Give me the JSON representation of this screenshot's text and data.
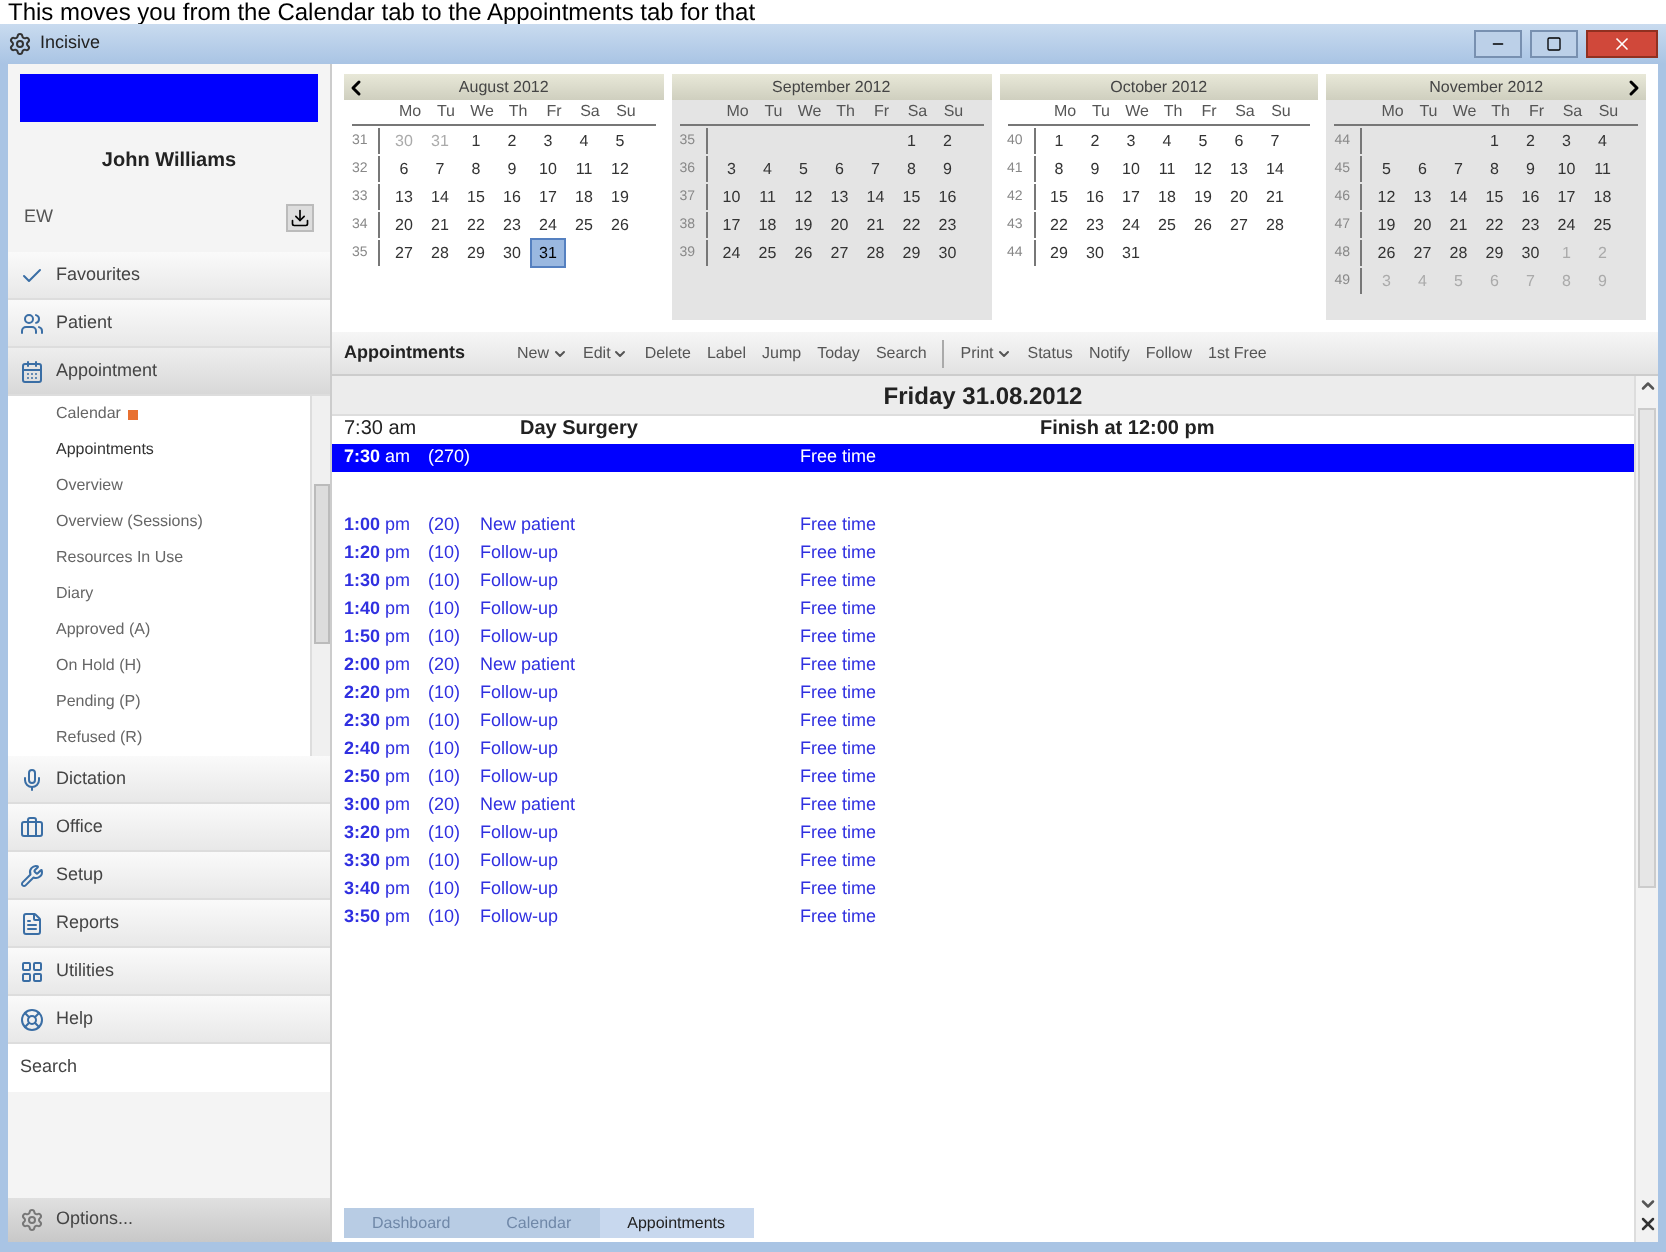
{
  "caption": "This moves you from the Calendar tab to the Appointments tab for that",
  "window": {
    "title": "Incisive"
  },
  "user": {
    "name": "John Williams",
    "initials": "EW"
  },
  "nav": [
    {
      "label": "Favourites",
      "expanded": false
    },
    {
      "label": "Patient",
      "expanded": false
    },
    {
      "label": "Appointment",
      "expanded": true,
      "children": [
        {
          "label": "Calendar",
          "flagged": true,
          "selected": false
        },
        {
          "label": "Appointments",
          "flagged": false,
          "selected": true
        },
        {
          "label": "Overview",
          "flagged": false,
          "selected": false
        },
        {
          "label": "Overview (Sessions)",
          "flagged": false,
          "selected": false
        },
        {
          "label": "Resources In Use",
          "flagged": false,
          "selected": false
        },
        {
          "label": "Diary",
          "flagged": false,
          "selected": false
        },
        {
          "label": "Approved (A)",
          "flagged": false,
          "selected": false
        },
        {
          "label": "On Hold (H)",
          "flagged": false,
          "selected": false
        },
        {
          "label": "Pending (P)",
          "flagged": false,
          "selected": false
        },
        {
          "label": "Refused (R)",
          "flagged": false,
          "selected": false
        }
      ]
    },
    {
      "label": "Dictation",
      "expanded": false
    },
    {
      "label": "Office",
      "expanded": false
    },
    {
      "label": "Setup",
      "expanded": false
    },
    {
      "label": "Reports",
      "expanded": false
    },
    {
      "label": "Utilities",
      "expanded": false
    },
    {
      "label": "Help",
      "expanded": false
    }
  ],
  "search_label": "Search",
  "options_label": "Options...",
  "months": [
    {
      "title": "August 2012",
      "shaded": false,
      "weekdays": [
        "Mo",
        "Tu",
        "We",
        "Th",
        "Fr",
        "Sa",
        "Su"
      ],
      "weeks": [
        {
          "week": "31",
          "lead": [
            "30",
            "31"
          ],
          "days": [
            "1",
            "2",
            "3",
            "4",
            "5"
          ]
        },
        {
          "week": "32",
          "days": [
            "6",
            "7",
            "8",
            "9",
            "10",
            "11",
            "12"
          ]
        },
        {
          "week": "33",
          "days": [
            "13",
            "14",
            "15",
            "16",
            "17",
            "18",
            "19"
          ]
        },
        {
          "week": "34",
          "days": [
            "20",
            "21",
            "22",
            "23",
            "24",
            "25",
            "26"
          ]
        },
        {
          "week": "35",
          "days": [
            "27",
            "28",
            "29",
            "30"
          ],
          "selected_day": "31"
        }
      ]
    },
    {
      "title": "September 2012",
      "shaded": true,
      "weekdays": [
        "Mo",
        "Tu",
        "We",
        "Th",
        "Fr",
        "Sa",
        "Su"
      ],
      "weeks": [
        {
          "week": "35",
          "days": [
            "1",
            "2"
          ]
        },
        {
          "week": "36",
          "days": [
            "3",
            "4",
            "5",
            "6",
            "7",
            "8",
            "9"
          ]
        },
        {
          "week": "37",
          "days": [
            "10",
            "11",
            "12",
            "13",
            "14",
            "15",
            "16"
          ]
        },
        {
          "week": "38",
          "days": [
            "17",
            "18",
            "19",
            "20",
            "21",
            "22",
            "23"
          ]
        },
        {
          "week": "39",
          "days": [
            "24",
            "25",
            "26",
            "27",
            "28",
            "29",
            "30"
          ]
        }
      ]
    },
    {
      "title": "October 2012",
      "shaded": false,
      "weekdays": [
        "Mo",
        "Tu",
        "We",
        "Th",
        "Fr",
        "Sa",
        "Su"
      ],
      "weeks": [
        {
          "week": "40",
          "days": [
            "1",
            "2",
            "3",
            "4",
            "5",
            "6",
            "7"
          ]
        },
        {
          "week": "41",
          "days": [
            "8",
            "9",
            "10",
            "11",
            "12",
            "13",
            "14"
          ]
        },
        {
          "week": "42",
          "days": [
            "15",
            "16",
            "17",
            "18",
            "19",
            "20",
            "21"
          ]
        },
        {
          "week": "43",
          "days": [
            "22",
            "23",
            "24",
            "25",
            "26",
            "27",
            "28"
          ]
        },
        {
          "week": "44",
          "days": [
            "29",
            "30",
            "31"
          ]
        }
      ]
    },
    {
      "title": "November 2012",
      "shaded": true,
      "weekdays": [
        "Mo",
        "Tu",
        "We",
        "Th",
        "Fr",
        "Sa",
        "Su"
      ],
      "weeks": [
        {
          "week": "44",
          "days": [
            "1",
            "2",
            "3",
            "4"
          ]
        },
        {
          "week": "45",
          "days": [
            "5",
            "6",
            "7",
            "8",
            "9",
            "10",
            "11"
          ]
        },
        {
          "week": "46",
          "days": [
            "12",
            "13",
            "14",
            "15",
            "16",
            "17",
            "18"
          ]
        },
        {
          "week": "47",
          "days": [
            "19",
            "20",
            "21",
            "22",
            "23",
            "24",
            "25"
          ]
        },
        {
          "week": "48",
          "days": [
            "26",
            "27",
            "28",
            "29",
            "30"
          ],
          "trail": [
            "1",
            "2"
          ]
        },
        {
          "week": "49",
          "trail": [
            "3",
            "4",
            "5",
            "6",
            "7",
            "8",
            "9"
          ]
        }
      ]
    }
  ],
  "toolbar": {
    "title": "Appointments",
    "groups": [
      [
        {
          "label": "New",
          "dropdown": true
        },
        {
          "label": "Edit",
          "dropdown": true
        },
        {
          "label": "Delete",
          "dropdown": false
        },
        {
          "label": "Label",
          "dropdown": false
        },
        {
          "label": "Jump",
          "dropdown": false
        },
        {
          "label": "Today",
          "dropdown": false
        },
        {
          "label": "Search",
          "dropdown": false
        }
      ],
      [
        {
          "label": "Print",
          "dropdown": true
        },
        {
          "label": "Status",
          "dropdown": false
        },
        {
          "label": "Notify",
          "dropdown": false
        },
        {
          "label": "Follow",
          "dropdown": false
        },
        {
          "label": "1st Free",
          "dropdown": false
        }
      ]
    ]
  },
  "date_header": "Friday 31.08.2012",
  "session": {
    "time": "7:30 am",
    "name": "Day Surgery",
    "finish": "Finish at 12:00 pm"
  },
  "slots": [
    {
      "time": "7:30",
      "ampm": "am",
      "duration": "(270)",
      "status": "Free time",
      "selected": true,
      "gap_after": true
    },
    {
      "time": "1:00",
      "ampm": "pm",
      "duration": "(20)",
      "type": "New patient",
      "status": "Free time",
      "selected": false
    },
    {
      "time": "1:20",
      "ampm": "pm",
      "duration": "(10)",
      "type": "Follow-up",
      "status": "Free time",
      "selected": false
    },
    {
      "time": "1:30",
      "ampm": "pm",
      "duration": "(10)",
      "type": "Follow-up",
      "status": "Free time",
      "selected": false
    },
    {
      "time": "1:40",
      "ampm": "pm",
      "duration": "(10)",
      "type": "Follow-up",
      "status": "Free time",
      "selected": false
    },
    {
      "time": "1:50",
      "ampm": "pm",
      "duration": "(10)",
      "type": "Follow-up",
      "status": "Free time",
      "selected": false
    },
    {
      "time": "2:00",
      "ampm": "pm",
      "duration": "(20)",
      "type": "New patient",
      "status": "Free time",
      "selected": false
    },
    {
      "time": "2:20",
      "ampm": "pm",
      "duration": "(10)",
      "type": "Follow-up",
      "status": "Free time",
      "selected": false
    },
    {
      "time": "2:30",
      "ampm": "pm",
      "duration": "(10)",
      "type": "Follow-up",
      "status": "Free time",
      "selected": false
    },
    {
      "time": "2:40",
      "ampm": "pm",
      "duration": "(10)",
      "type": "Follow-up",
      "status": "Free time",
      "selected": false
    },
    {
      "time": "2:50",
      "ampm": "pm",
      "duration": "(10)",
      "type": "Follow-up",
      "status": "Free time",
      "selected": false
    },
    {
      "time": "3:00",
      "ampm": "pm",
      "duration": "(20)",
      "type": "New patient",
      "status": "Free time",
      "selected": false
    },
    {
      "time": "3:20",
      "ampm": "pm",
      "duration": "(10)",
      "type": "Follow-up",
      "status": "Free time",
      "selected": false
    },
    {
      "time": "3:30",
      "ampm": "pm",
      "duration": "(10)",
      "type": "Follow-up",
      "status": "Free time",
      "selected": false
    },
    {
      "time": "3:40",
      "ampm": "pm",
      "duration": "(10)",
      "type": "Follow-up",
      "status": "Free time",
      "selected": false
    },
    {
      "time": "3:50",
      "ampm": "pm",
      "duration": "(10)",
      "type": "Follow-up",
      "status": "Free time",
      "selected": false
    }
  ],
  "bottom_tabs": [
    {
      "label": "Dashboard",
      "selected": false
    },
    {
      "label": "Calendar",
      "selected": false
    },
    {
      "label": "Appointments",
      "selected": true
    }
  ]
}
